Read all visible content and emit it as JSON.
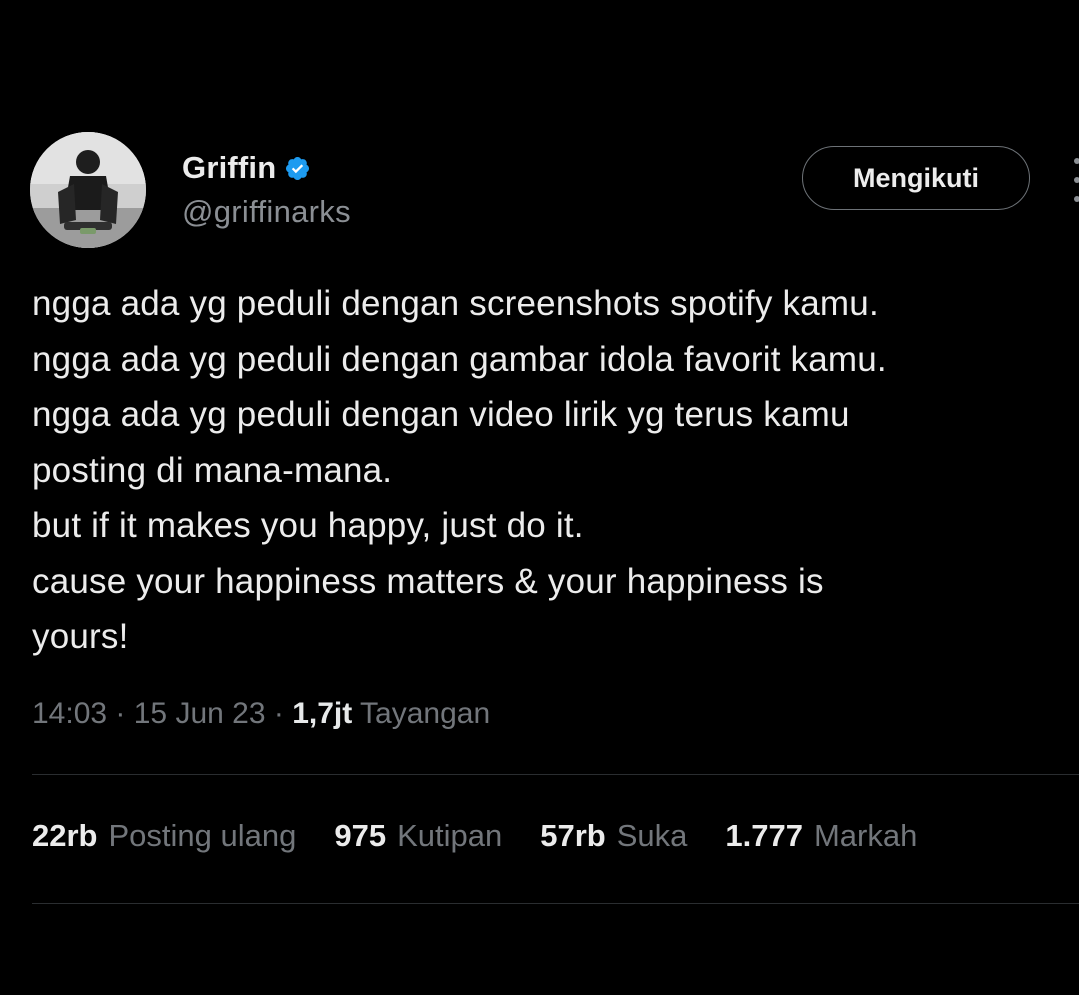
{
  "author": {
    "display_name": "Griffin",
    "handle": "@griffinarks",
    "verified_icon": "verified-badge-icon",
    "verified_color": "#1d9bf0"
  },
  "follow_button": {
    "label": "Mengikuti"
  },
  "more_menu": {
    "icon": "more-vertical-icon"
  },
  "tweet": {
    "lines": [
      "ngga ada yg peduli dengan screenshots spotify kamu.",
      "ngga ada yg peduli dengan gambar idola favorit kamu.",
      "ngga ada yg peduli dengan video lirik yg terus kamu",
      "posting di mana-mana.",
      "but if it makes you happy,  just do it.",
      "cause your happiness matters & your happiness is",
      "yours!"
    ]
  },
  "meta": {
    "time": "14:03",
    "separator": "·",
    "date": "15 Jun 23",
    "views_count": "1,7jt",
    "views_label": "Tayangan"
  },
  "stats": [
    {
      "count": "22rb",
      "label": "Posting ulang"
    },
    {
      "count": "975",
      "label": "Kutipan"
    },
    {
      "count": "57rb",
      "label": "Suka"
    },
    {
      "count": "1.777",
      "label": "Markah"
    }
  ],
  "colors": {
    "background": "#000000",
    "text_primary": "#ececec",
    "text_secondary": "#72767b",
    "divider": "#2a2d30"
  }
}
